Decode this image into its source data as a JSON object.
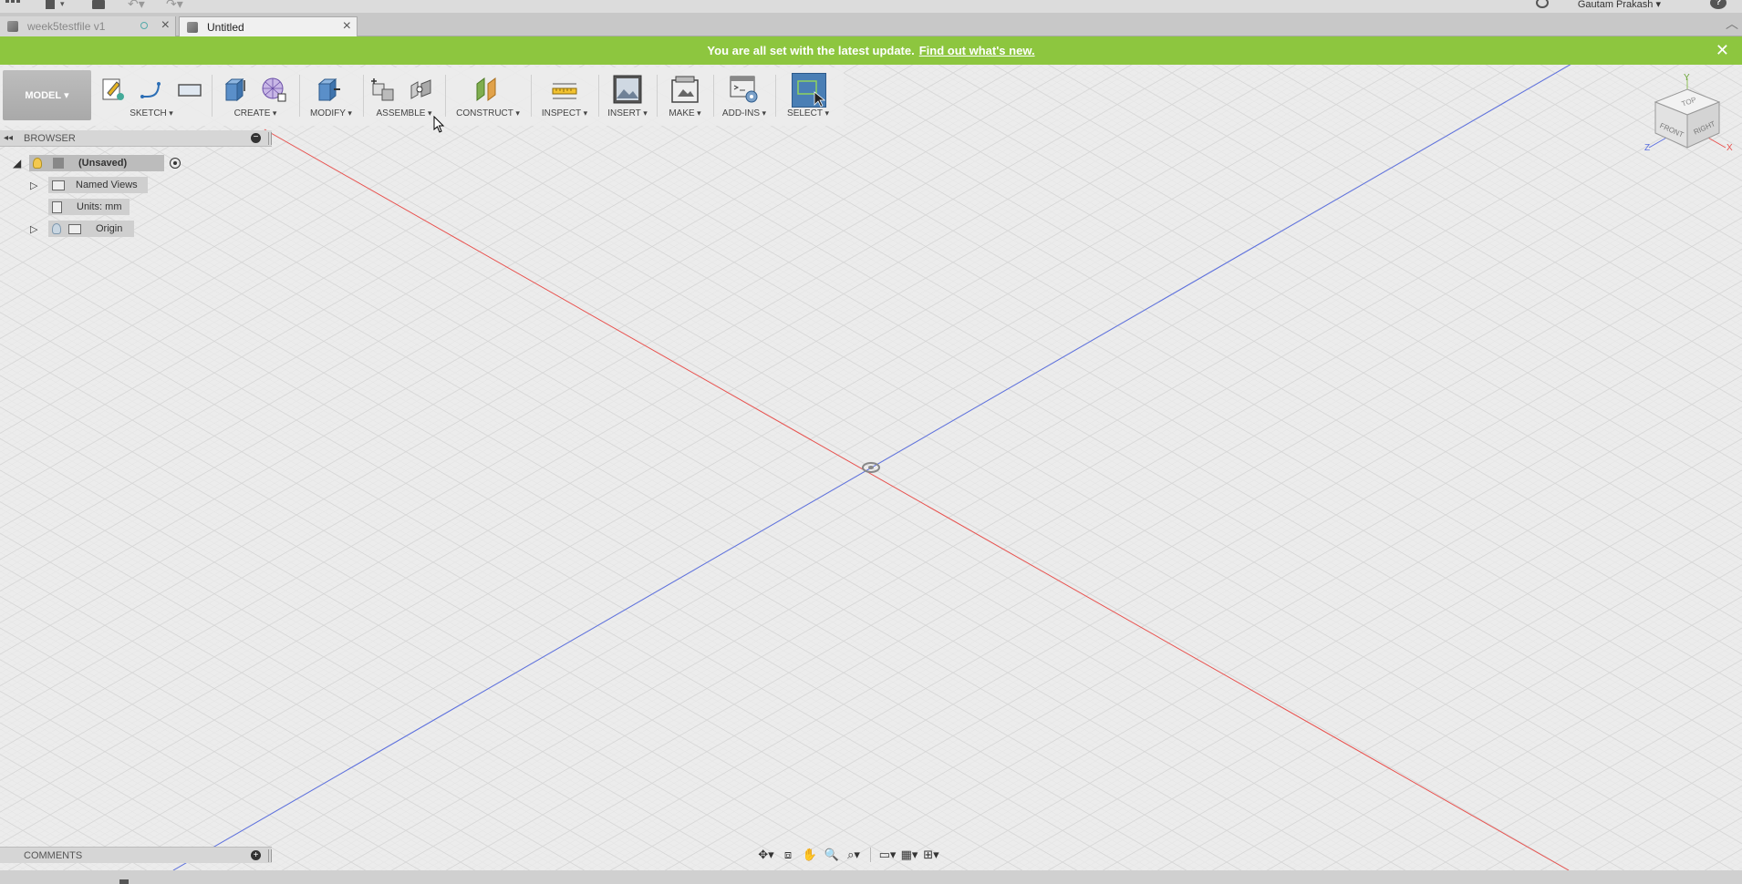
{
  "appbar": {
    "user_name": "Gautam Prakash",
    "help_label": "?",
    "icons": [
      "apps-grid-icon",
      "file-icon",
      "save-icon",
      "undo-icon",
      "redo-icon",
      "job-status-icon",
      "help-icon"
    ]
  },
  "tabs": [
    {
      "label": "week5testfile v1",
      "active": false
    },
    {
      "label": "Untitled",
      "active": true
    }
  ],
  "banner": {
    "message": "You are all set with the latest update.",
    "link": "Find out what's new.",
    "color": "#8dc63f"
  },
  "toolbar": {
    "workspace": "MODEL",
    "groups": [
      {
        "label": "SKETCH",
        "icons": [
          "create-sketch-icon",
          "line-icon",
          "rectangle-icon"
        ]
      },
      {
        "label": "CREATE",
        "icons": [
          "extrude-icon",
          "form-icon"
        ]
      },
      {
        "label": "MODIFY",
        "icons": [
          "press-pull-icon"
        ]
      },
      {
        "label": "ASSEMBLE",
        "icons": [
          "new-component-icon",
          "joint-icon"
        ]
      },
      {
        "label": "CONSTRUCT",
        "icons": [
          "offset-plane-icon"
        ]
      },
      {
        "label": "INSPECT",
        "icons": [
          "measure-icon"
        ]
      },
      {
        "label": "INSERT",
        "icons": [
          "insert-image-icon"
        ]
      },
      {
        "label": "MAKE",
        "icons": [
          "3d-print-icon"
        ]
      },
      {
        "label": "ADD-INS",
        "icons": [
          "scripts-addins-icon"
        ]
      },
      {
        "label": "SELECT",
        "icons": [
          "select-icon"
        ]
      }
    ]
  },
  "browser": {
    "title": "BROWSER",
    "root": "(Unsaved)",
    "items": [
      {
        "label": "Named Views"
      },
      {
        "label": "Units: mm"
      },
      {
        "label": "Origin"
      }
    ]
  },
  "comments": {
    "title": "COMMENTS"
  },
  "viewcube": {
    "top": "TOP",
    "front": "FRONT",
    "right": "RIGHT",
    "axis_x": "X",
    "axis_y": "Y",
    "axis_z": "Z"
  },
  "colors": {
    "x_axis": "#e8524f",
    "z_axis": "#5b6fe0",
    "select_active": "#4a7fb5"
  }
}
